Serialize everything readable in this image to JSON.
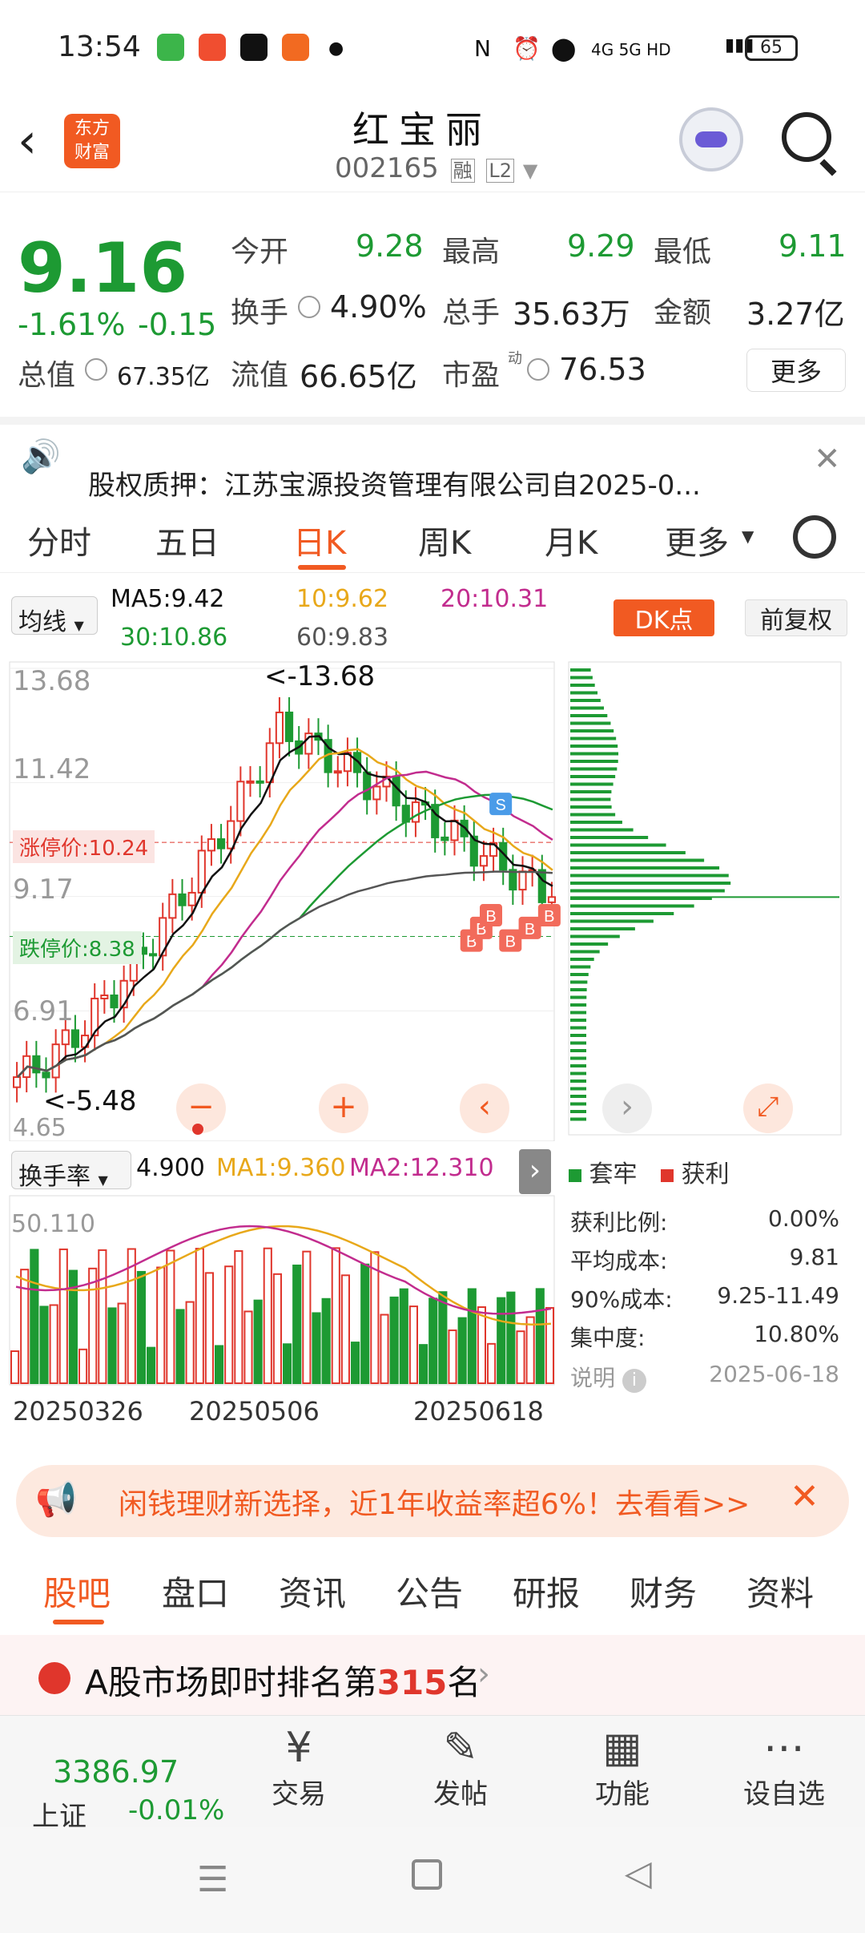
{
  "status_bar": {
    "time": "13:54",
    "battery": "65",
    "network": "4G 5G HD"
  },
  "header": {
    "title": "红宝丽",
    "code": "002165",
    "badge_rong": "融",
    "badge_l2": "L2",
    "logo_text_1": "东方",
    "logo_text_2": "财富"
  },
  "quote": {
    "price": "9.16",
    "change_pct": "-1.61%",
    "change": "-0.15",
    "open_label": "今开",
    "open": "9.28",
    "high_label": "最高",
    "high": "9.29",
    "low_label": "最低",
    "low": "9.11",
    "turnover_label": "换手",
    "turnover": "4.90%",
    "volume_label": "总手",
    "volume": "35.63万",
    "amount_label": "金额",
    "amount": "3.27亿",
    "mktcap_label": "总值",
    "mktcap": "67.35亿",
    "float_label": "流值",
    "float": "66.65亿",
    "pe_label": "市盈",
    "pe_sup": "动",
    "pe": "76.53",
    "more_button": "更多"
  },
  "notice": {
    "text": "股权质押：江苏宝源投资管理有限公司自2025-0..."
  },
  "kline_tabs": [
    "分时",
    "五日",
    "日K",
    "周K",
    "月K",
    "更多"
  ],
  "kline_tab_active": 2,
  "chart_toolbar": {
    "ma_select": "均线",
    "ma5": "MA5:9.42",
    "ma10": "10:9.62",
    "ma20": "20:10.31",
    "ma30": "30:10.86",
    "ma60": "60:9.83",
    "dk_button": "DK点",
    "fq_button": "前复权"
  },
  "chart_labels": {
    "y_top": "13.68",
    "y_2": "11.42",
    "y_3": "9.17",
    "y_4": "6.91",
    "y_bottom": "4.65",
    "high_mark": "13.68",
    "low_mark": "5.48",
    "limit_up": "涨停价:10.24",
    "limit_down": "跌停价:8.38"
  },
  "chart_data": {
    "type": "candlestick",
    "ylim": [
      4.65,
      13.68
    ],
    "x_start": "20250326",
    "x_ticks": [
      "20250326",
      "20250506",
      "20250618"
    ],
    "max_high": 13.68,
    "min_low": 5.48,
    "last_close": 9.16,
    "ma5": 9.42,
    "ma10": 9.62,
    "ma20": 10.31,
    "ma30": 10.86,
    "ma60": 9.83,
    "limit_up": 10.24,
    "limit_down": 8.38,
    "trade_signals": [
      "S",
      "B"
    ]
  },
  "volume_panel": {
    "select": "换手率",
    "value": "4.900",
    "ma1": "MA1:9.360",
    "ma2": "MA2:12.310",
    "y_top": "50.110"
  },
  "chip_panel": {
    "legend_loss": "套牢",
    "legend_profit": "获利",
    "rows": [
      {
        "label": "获利比例:",
        "value": "0.00%"
      },
      {
        "label": "平均成本:",
        "value": "9.81"
      },
      {
        "label": "90%成本:",
        "value": "9.25-11.49"
      },
      {
        "label": "集中度:",
        "value": "10.80%"
      }
    ],
    "explain": "说明",
    "date": "2025-06-18"
  },
  "ad": {
    "text": "闲钱理财新选择，近1年收益率超6%！去看看>>"
  },
  "section_tabs": [
    "股吧",
    "盘口",
    "资讯",
    "公告",
    "研报",
    "财务",
    "资料"
  ],
  "section_tab_active": 0,
  "rank": {
    "prefix": "A股市场即时排名第",
    "num": "315",
    "suffix": "名"
  },
  "bottom_bar": {
    "index_value": "3386.97",
    "index_name": "上证",
    "index_change": "-0.01%",
    "items": [
      "交易",
      "发帖",
      "功能",
      "设自选"
    ]
  },
  "colors": {
    "up": "#e0362c",
    "down": "#1d9a33",
    "accent": "#f15a22"
  }
}
